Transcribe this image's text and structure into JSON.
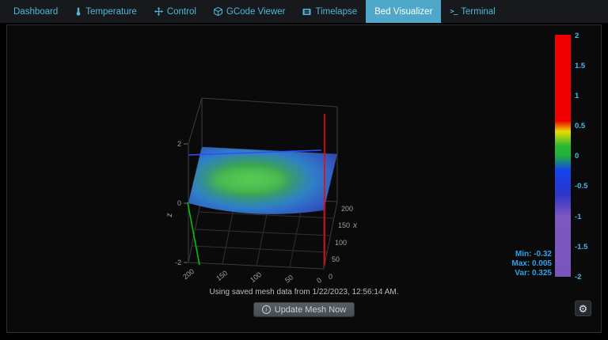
{
  "navbar": {
    "bg_color": "#17191c",
    "link_color": "#4cb9d9",
    "active_bg_color": "#4fa8ca",
    "active_text_color": "#ffffff",
    "tabs": [
      {
        "label": "Dashboard",
        "active": false
      },
      {
        "label": "Temperature",
        "icon": "thermometer-icon",
        "active": false
      },
      {
        "label": "Control",
        "icon": "arrows-icon",
        "active": false
      },
      {
        "label": "GCode Viewer",
        "icon": "cube-icon",
        "active": false
      },
      {
        "label": "Timelapse",
        "icon": "film-icon",
        "active": false
      },
      {
        "label": "Bed Visualizer",
        "active": true
      },
      {
        "label": "Terminal",
        "icon": "terminal-icon",
        "active": false
      }
    ]
  },
  "plot": {
    "axis": {
      "x_title": "x",
      "z_title": "z",
      "x_ticks": [
        "0",
        "50",
        "100",
        "150",
        "200"
      ],
      "y_ticks": [
        "200",
        "150",
        "100",
        "50",
        "0"
      ],
      "z_ticks": [
        "2",
        "0",
        "-2"
      ]
    },
    "colorbar": {
      "ticks": [
        "2",
        "1.5",
        "1",
        "0.5",
        "0",
        "-0.5",
        "-1",
        "-1.5",
        "-2"
      ],
      "tick_color": "#46b8e8",
      "colors_top_to_bottom": [
        "#ee0000",
        "#e8dc00",
        "#1faf3c",
        "#1544ee",
        "#7e57c2"
      ]
    },
    "stats": {
      "min": "Min: -0.32",
      "max": "Max: 0.005",
      "var": "Var: 0.325",
      "color": "#2fa3e8"
    },
    "axis_line_colors": {
      "red": "#ff0000",
      "green": "#00c400",
      "blue": "#2a50ff"
    }
  },
  "status": {
    "message": "Using saved mesh data from 1/22/2023, 12:56:14 AM."
  },
  "actions": {
    "update_button_label": "Update Mesh Now",
    "update_button_icon": "info-icon",
    "settings_button_icon": "gear-icon"
  },
  "chart_data": {
    "type": "surface",
    "title": "",
    "x_range": [
      0,
      200
    ],
    "y_range": [
      0,
      200
    ],
    "z_range": [
      -2,
      2
    ],
    "colorbar_range": [
      -2,
      2
    ],
    "stats": {
      "min": -0.32,
      "max": 0.005,
      "variance": 0.325
    },
    "values_approximate": true,
    "x": [
      0,
      50,
      100,
      150,
      200
    ],
    "y": [
      0,
      50,
      100,
      150,
      200
    ],
    "z_grid": [
      [
        -0.3,
        -0.24,
        -0.2,
        -0.24,
        -0.3
      ],
      [
        -0.24,
        -0.12,
        -0.06,
        -0.12,
        -0.26
      ],
      [
        -0.2,
        -0.05,
        0.005,
        -0.06,
        -0.22
      ],
      [
        -0.26,
        -0.12,
        -0.05,
        -0.14,
        -0.28
      ],
      [
        -0.32,
        -0.26,
        -0.2,
        -0.26,
        -0.31
      ]
    ]
  }
}
